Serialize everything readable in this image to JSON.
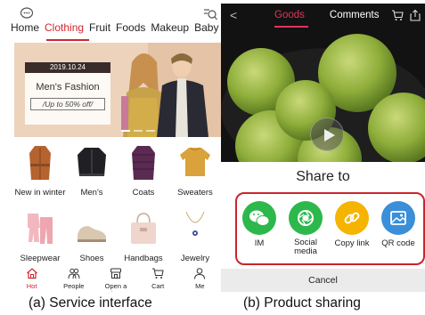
{
  "left_screen": {
    "categories": [
      "Home",
      "Clothing",
      "Fruit",
      "Foods",
      "Makeup",
      "Baby"
    ],
    "active_category": "Clothing",
    "banner": {
      "date": "2019.10.24",
      "title": "Men's Fashion",
      "subtitle": "Up to 50% off"
    },
    "products": [
      {
        "label": "New in winter",
        "icon": "coat-icon"
      },
      {
        "label": "Men's",
        "icon": "jacket-icon"
      },
      {
        "label": "Coats",
        "icon": "puffer-icon"
      },
      {
        "label": "Sweaters",
        "icon": "sweater-icon"
      },
      {
        "label": "Sleepwear",
        "icon": "pajama-icon"
      },
      {
        "label": "Shoes",
        "icon": "shoe-icon"
      },
      {
        "label": "Handbags",
        "icon": "handbag-icon"
      },
      {
        "label": "Jewelry",
        "icon": "necklace-icon"
      }
    ],
    "bottom_tabs": [
      {
        "label": "Hot",
        "icon": "home-icon",
        "active": true
      },
      {
        "label": "People",
        "icon": "people-icon",
        "active": false
      },
      {
        "label": "Open a shop!",
        "icon": "shop-icon",
        "active": false
      },
      {
        "label": "Cart",
        "icon": "cart-icon",
        "active": false
      },
      {
        "label": "Me",
        "icon": "person-icon",
        "active": false
      }
    ],
    "accent_color": "#d0262f"
  },
  "right_screen": {
    "tabs": [
      "Goods",
      "Comments"
    ],
    "active_tab": "Goods",
    "share_title": "Share to",
    "share_options": [
      {
        "label": "IM",
        "icon": "chat-icon",
        "color": "#2db84c"
      },
      {
        "label": "Social media",
        "icon": "camera-aperture-icon",
        "color": "#2db84c"
      },
      {
        "label": "Copy link",
        "icon": "link-icon",
        "color": "#f5b400"
      },
      {
        "label": "QR code",
        "icon": "image-icon",
        "color": "#3a8fd8"
      }
    ],
    "cancel_label": "Cancel",
    "highlight_color": "#c9252c"
  },
  "captions": {
    "left": "(a) Service interface",
    "right": "(b) Product sharing"
  }
}
